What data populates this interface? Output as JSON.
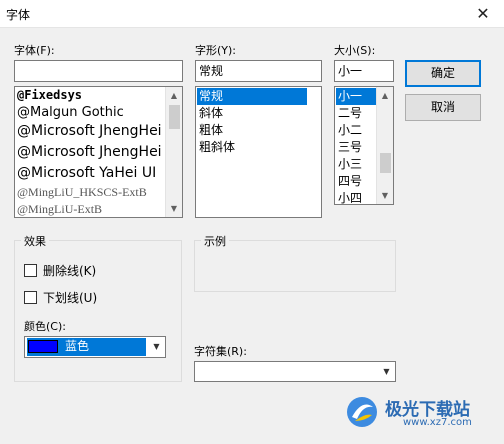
{
  "window": {
    "title": "字体",
    "close_glyph": "✕"
  },
  "font": {
    "label": "字体(F):",
    "value": "",
    "items": [
      "@Fixedsys",
      "@Malgun Gothic",
      "@Microsoft JhengHei",
      "@Microsoft JhengHei UI",
      "@Microsoft YaHei UI",
      "@MingLiU_HKSCS-ExtB",
      "@MingLiU-ExtB"
    ],
    "scroll_up": "▲",
    "scroll_down": "▼"
  },
  "style": {
    "label": "字形(Y):",
    "value": "常规",
    "items": [
      "常规",
      "斜体",
      "粗体",
      "粗斜体"
    ],
    "selected_index": 0
  },
  "size": {
    "label": "大小(S):",
    "value": "小一",
    "items": [
      "小一",
      "二号",
      "小二",
      "三号",
      "小三",
      "四号",
      "小四"
    ],
    "selected_index": 0,
    "scroll_up": "▲",
    "scroll_down": "▼"
  },
  "buttons": {
    "ok": "确定",
    "cancel": "取消"
  },
  "effects": {
    "legend": "效果",
    "strikeout": "删除线(K)",
    "underline": "下划线(U)",
    "strikeout_checked": false,
    "underline_checked": false,
    "color_label": "颜色(C):",
    "color_value": "蓝色",
    "color_hex": "#0000ff",
    "dropdown_arrow": "▼"
  },
  "sample": {
    "legend": "示例"
  },
  "charset": {
    "label": "字符集(R):",
    "value": "",
    "dropdown_arrow": "▼"
  },
  "watermark": {
    "name": "极光下载站",
    "url": "www.xz7.com"
  },
  "colors": {
    "selection": "#0078d7",
    "dialog_bg": "#f0f0f0"
  }
}
